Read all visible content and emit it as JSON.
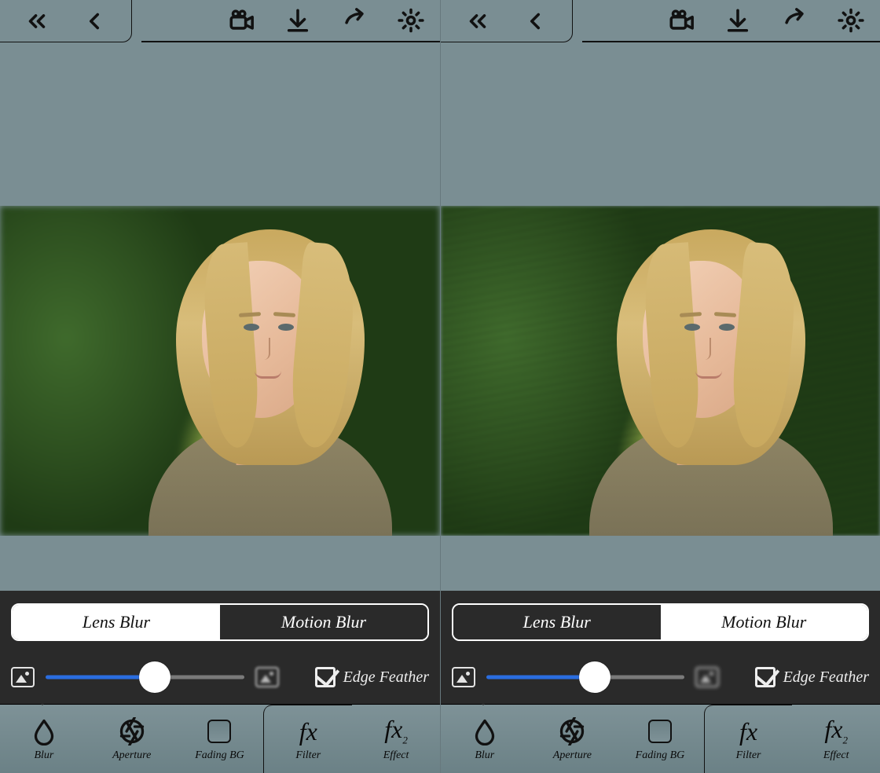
{
  "panes": [
    {
      "seg": {
        "lens": "Lens Blur",
        "motion": "Motion Blur",
        "active": "lens"
      },
      "slider_pct": 55,
      "edge_feather_label": "Edge Feather",
      "blur_style": "lens"
    },
    {
      "seg": {
        "lens": "Lens Blur",
        "motion": "Motion Blur",
        "active": "motion"
      },
      "slider_pct": 55,
      "edge_feather_label": "Edge Feather",
      "blur_style": "motion"
    }
  ],
  "tabs": {
    "blur": "Blur",
    "aperture": "Aperture",
    "fading_bg": "Fading BG",
    "filter": "Filter",
    "effect": "Effect"
  },
  "top_actions": {
    "back_all": "back-all",
    "back_one": "back",
    "record": "record-video",
    "download": "download",
    "share": "share",
    "settings": "settings"
  }
}
